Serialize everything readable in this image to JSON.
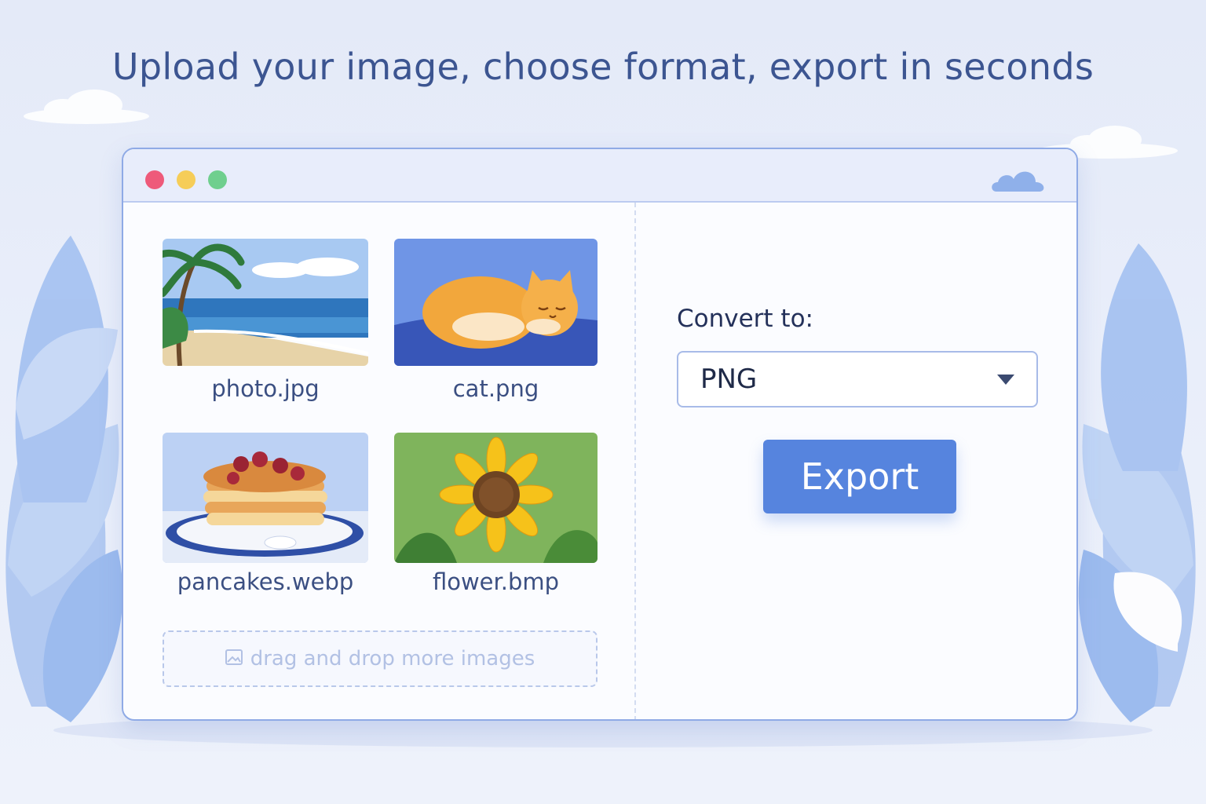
{
  "headline": "Upload your image, choose format, export in seconds",
  "window": {
    "controls": [
      "close",
      "minimize",
      "maximize"
    ],
    "corner_icon": "cloud-icon"
  },
  "files": [
    {
      "name": "photo.jpg",
      "thumbnail": "beach-scene"
    },
    {
      "name": "cat.png",
      "thumbnail": "sleeping-cat"
    },
    {
      "name": "pancakes.webp",
      "thumbnail": "pancake-stack"
    },
    {
      "name": "flower.bmp",
      "thumbnail": "sunflower"
    }
  ],
  "dropzone": {
    "icon": "image-icon",
    "label": "drag and drop more images"
  },
  "converter": {
    "label": "Convert to:",
    "selected_format": "PNG",
    "export_label": "Export"
  },
  "colors": {
    "accent": "#5684de",
    "window_border": "#8faae6",
    "heading": "#3c5591"
  }
}
